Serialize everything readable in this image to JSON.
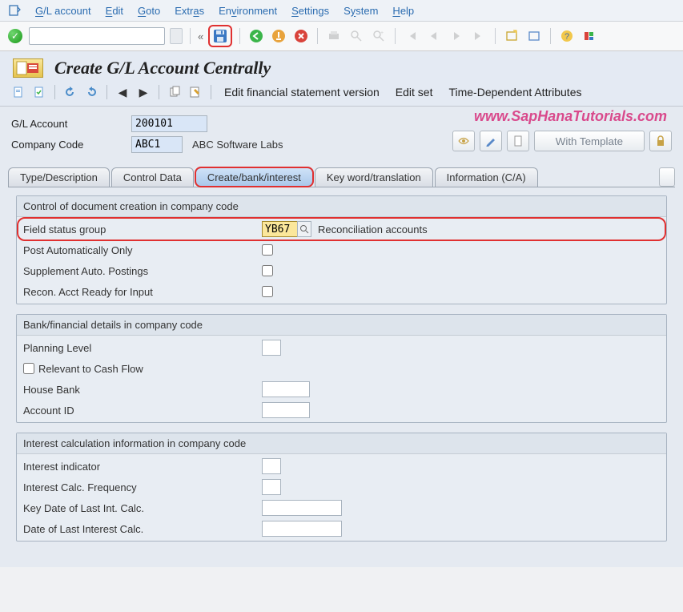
{
  "menu": {
    "items": [
      "G/L account",
      "Edit",
      "Goto",
      "Extras",
      "Environment",
      "Settings",
      "System",
      "Help"
    ]
  },
  "title": "Create G/L Account Centrally",
  "watermark": "www.SapHanaTutorials.com",
  "subbar": {
    "action1": "Edit financial statement version",
    "action2": "Edit set",
    "action3": "Time-Dependent Attributes"
  },
  "header": {
    "gl_label": "G/L Account",
    "gl_value": "200101",
    "cc_label": "Company Code",
    "cc_value": "ABC1",
    "cc_desc": "ABC Software Labs",
    "with_template": "With Template"
  },
  "tabs": [
    "Type/Description",
    "Control Data",
    "Create/bank/interest",
    "Key word/translation",
    "Information (C/A)"
  ],
  "group1": {
    "title": "Control of document creation in company code",
    "fsg_label": "Field status group",
    "fsg_value": "YB67",
    "fsg_desc": "Reconciliation accounts",
    "post_auto": "Post Automatically Only",
    "supp_auto": "Supplement Auto. Postings",
    "recon": "Recon. Acct Ready for Input"
  },
  "group2": {
    "title": "Bank/financial details in company code",
    "planning": "Planning Level",
    "cashflow": "Relevant to Cash Flow",
    "housebank": "House Bank",
    "accountid": "Account ID"
  },
  "group3": {
    "title": "Interest calculation information in company code",
    "indicator": "Interest indicator",
    "freq": "Interest Calc. Frequency",
    "keydate": "Key Date of Last Int. Calc.",
    "lastdate": "Date of Last Interest Calc."
  }
}
